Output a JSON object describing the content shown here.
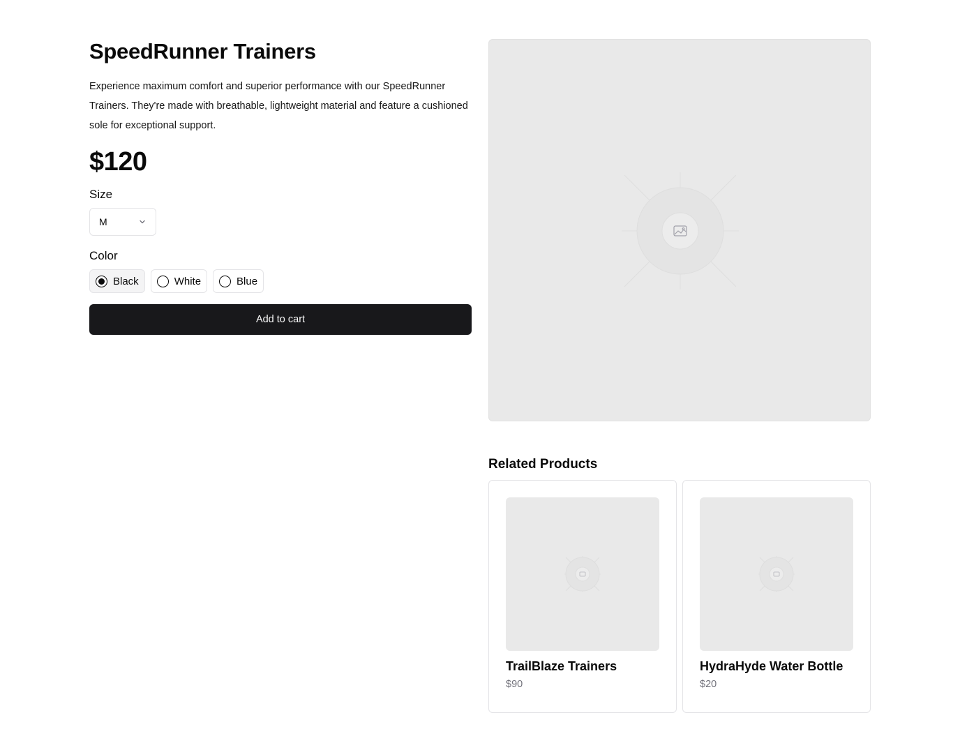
{
  "product": {
    "title": "SpeedRunner Trainers",
    "description": "Experience maximum comfort and superior performance with our SpeedRunner Trainers. They're made with breathable, lightweight material and feature a cushioned sole for exceptional support.",
    "price": "$120",
    "size_label": "Size",
    "size_value": "M",
    "color_label": "Color",
    "colors": [
      {
        "label": "Black",
        "selected": true
      },
      {
        "label": "White",
        "selected": false
      },
      {
        "label": "Blue",
        "selected": false
      }
    ],
    "add_to_cart_label": "Add to cart"
  },
  "related": {
    "title": "Related Products",
    "items": [
      {
        "name": "TrailBlaze Trainers",
        "price": "$90"
      },
      {
        "name": "HydraHyde Water Bottle",
        "price": "$20"
      }
    ]
  },
  "icons": {
    "image_placeholder": "image-icon",
    "select_chevron": "chevron-down-icon"
  },
  "colors": {
    "button_bg": "#18181b",
    "placeholder_bg": "#e9e9e9",
    "muted_text": "#71717a"
  }
}
